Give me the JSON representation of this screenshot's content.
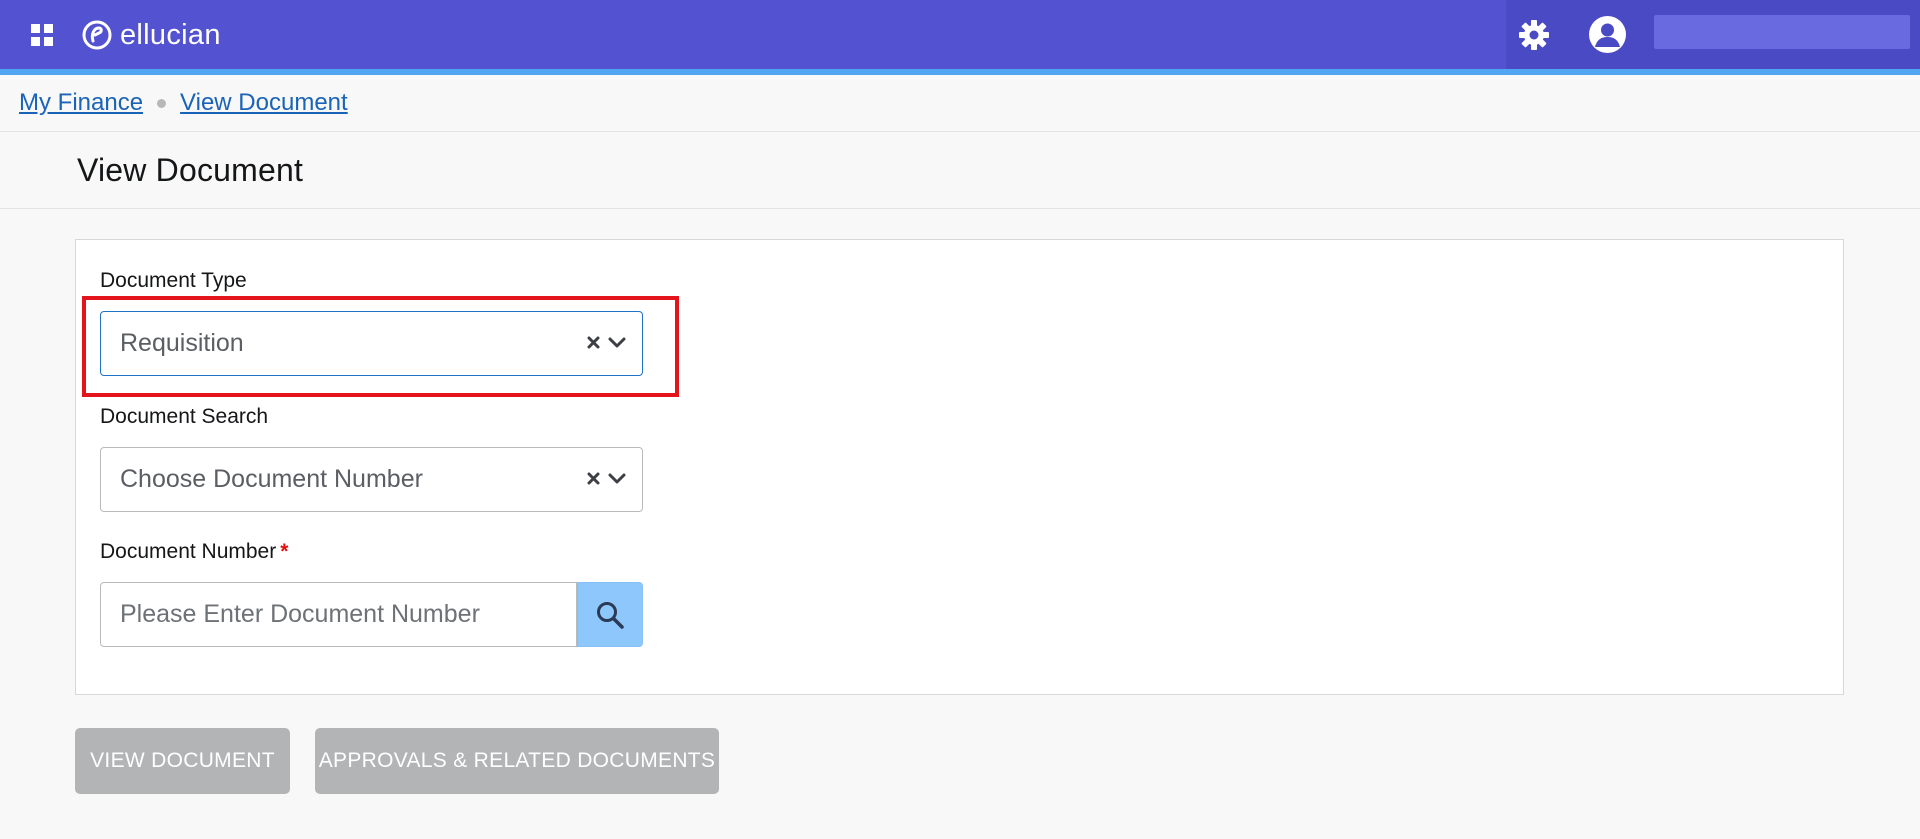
{
  "header": {
    "brand": "ellucian",
    "icons": [
      "apps-grid-icon",
      "ellucian-logo-icon",
      "gear-icon",
      "user-avatar-icon"
    ],
    "colors": {
      "bar": "#5353d1",
      "accent": "#4fa5f2"
    }
  },
  "breadcrumb": {
    "items": [
      "My Finance",
      "View Document"
    ]
  },
  "page": {
    "title": "View Document"
  },
  "form": {
    "document_type": {
      "label": "Document Type",
      "value": "Requisition"
    },
    "document_search": {
      "label": "Document Search",
      "value": "Choose Document Number"
    },
    "document_number": {
      "label": "Document Number",
      "required_mark": "*",
      "placeholder": "Please Enter Document Number"
    }
  },
  "actions": {
    "view_document": "VIEW DOCUMENT",
    "approvals": "APPROVALS & RELATED DOCUMENTS"
  },
  "highlight": {
    "color": "#e3141b",
    "target": "document-type-select"
  }
}
